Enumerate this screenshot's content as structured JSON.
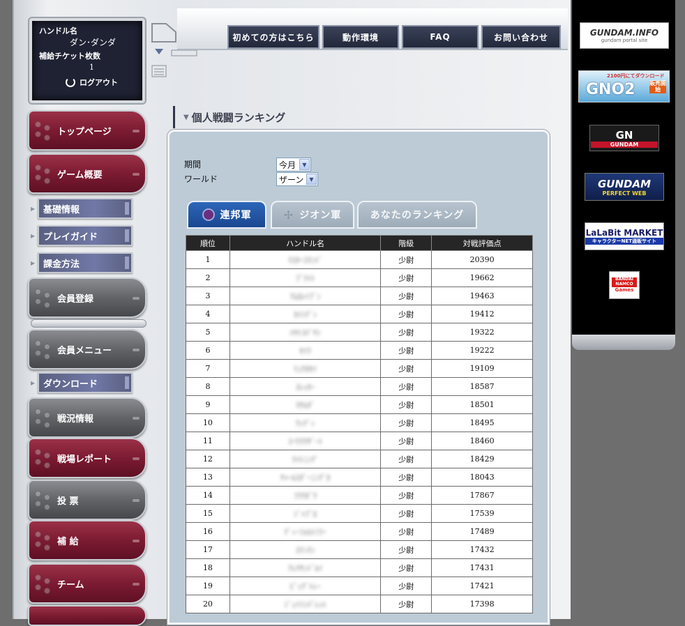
{
  "user": {
    "handle_label": "ハンドル名",
    "handle_value": "ダン･ダンダ",
    "tickets_label": "補給チケット枚数",
    "tickets_value": "1",
    "logout_label": "ログアウト"
  },
  "topnav": {
    "items": [
      "初めての方はこちら",
      "動作環境",
      "FAQ",
      "お問い合わせ"
    ]
  },
  "sidebar": {
    "items": [
      {
        "label": "トップページ",
        "style": "red"
      },
      {
        "label": "ゲーム概要",
        "style": "red"
      },
      {
        "label": "基礎情報",
        "style": "sub"
      },
      {
        "label": "プレイガイド",
        "style": "sub"
      },
      {
        "label": "課金方法",
        "style": "sub"
      },
      {
        "label": "会員登録",
        "style": "gray"
      },
      {
        "label": "会員メニュー",
        "style": "gray"
      },
      {
        "label": "ダウンロード",
        "style": "sub"
      },
      {
        "label": "戦況情報",
        "style": "gray"
      },
      {
        "label": "戦場レポート",
        "style": "red"
      },
      {
        "label": "投 票",
        "style": "gray"
      },
      {
        "label": "補 給",
        "style": "red"
      },
      {
        "label": "チーム",
        "style": "red"
      }
    ]
  },
  "main": {
    "title": "個人戦闘ランキング",
    "filters": {
      "period_label": "期間",
      "period_value": "今月",
      "world_label": "ワールド",
      "world_value": "ザーン"
    },
    "tabs": [
      {
        "label": "連邦軍",
        "active": true
      },
      {
        "label": "ジオン軍",
        "active": false
      },
      {
        "label": "あなたのランキング",
        "active": false
      }
    ],
    "table": {
      "headers": [
        "順位",
        "ハンドル名",
        "階級",
        "対戦評価点"
      ],
      "rows": [
        {
          "rank": "1",
          "name": "ﾏｽﾀｰｺﾏﾝﾄﾞ",
          "grade": "少尉",
          "score": "20390"
        },
        {
          "rank": "2",
          "name": "ﾌﾞﾗｲﾄ",
          "grade": "少尉",
          "score": "19662"
        },
        {
          "rank": "3",
          "name": "ｱﾑﾛﾚｲﾌﾞﾝ",
          "grade": "少尉",
          "score": "19463"
        },
        {
          "rank": "4",
          "name": "ｶｲｼﾃﾞﾝ",
          "grade": "少尉",
          "score": "19412"
        },
        {
          "rank": "5",
          "name": "ﾊﾔﾄｺﾊﾞﾔｼ",
          "grade": "少尉",
          "score": "19322"
        },
        {
          "rank": "6",
          "name": "ｾｲﾗ",
          "grade": "少尉",
          "score": "19222"
        },
        {
          "rank": "7",
          "name": "ﾘｭｳﾎｾｲ",
          "grade": "少尉",
          "score": "19109"
        },
        {
          "rank": "8",
          "name": "ｽﾚｯｶｰ",
          "grade": "少尉",
          "score": "18587"
        },
        {
          "rank": "9",
          "name": "ﾏﾁﾙﾀﾞ",
          "grade": "少尉",
          "score": "18501"
        },
        {
          "rank": "10",
          "name": "ｳｯﾃﾞｨ",
          "grade": "少尉",
          "score": "18495"
        },
        {
          "rank": "11",
          "name": "ｺｰｳﾗｳｻﾞｰﾄ",
          "grade": "少尉",
          "score": "18460"
        },
        {
          "rank": "12",
          "name": "ﾗｲﾄﾆﾝｸﾞ",
          "grade": "少尉",
          "score": "18429"
        },
        {
          "rank": "13",
          "name": "ﾁｬｰﾙｽﾀﾞｰﾆﾝｸﾞｶ",
          "grade": "少尉",
          "score": "18043"
        },
        {
          "rank": "14",
          "name": "ﾌﾗｳﾎﾞｳ",
          "grade": "少尉",
          "score": "17867"
        },
        {
          "rank": "15",
          "name": "ｼﾞｬﾌﾞﾛ",
          "grade": "少尉",
          "score": "17539"
        },
        {
          "rank": "16",
          "name": "ﾃﾞｨｰﾌｫﾙﾄﾐﾗｰ",
          "grade": "少尉",
          "score": "17489"
        },
        {
          "rank": "17",
          "name": "ｽﾃﾝﾏﾝ",
          "grade": "少尉",
          "score": "17432"
        },
        {
          "rank": "18",
          "name": "ｱﾚｸｻﾝﾄﾞﾙｲ",
          "grade": "少尉",
          "score": "17431"
        },
        {
          "rank": "19",
          "name": "ﾋﾞｯｸﾞﾄﾚｰ",
          "grade": "少尉",
          "score": "17421"
        },
        {
          "rank": "20",
          "name": "ｼﾞｪｲｿﾝﾊﾟﾚｯﾄ",
          "grade": "少尉",
          "score": "17398"
        }
      ]
    }
  },
  "banners": [
    {
      "name": "gundam-info",
      "text": "GUNDAM.INFO",
      "sub": "gundam portal site"
    },
    {
      "name": "gno2",
      "text": "GNO2",
      "sub": "2100円にてダウンロード",
      "badge": "販売開始"
    },
    {
      "name": "gno",
      "text": "GN",
      "sub": "GUNDAM"
    },
    {
      "name": "gundam-perfect-web",
      "text": "GUNDAM",
      "sub": "PERFECT WEB"
    },
    {
      "name": "lalabit",
      "text": "LaLaBit MARKET",
      "sub": "キャラクターNET通販サイト"
    },
    {
      "name": "bandai-namco",
      "text": "BANDAI NAMCO",
      "sub": "Games"
    }
  ],
  "colors": {
    "page_bg": "#6e6e6e",
    "panel_bg": "#bccbd6",
    "accent_red": "#7c1b32",
    "accent_blue": "#1a4791",
    "table_header": "#262626"
  }
}
